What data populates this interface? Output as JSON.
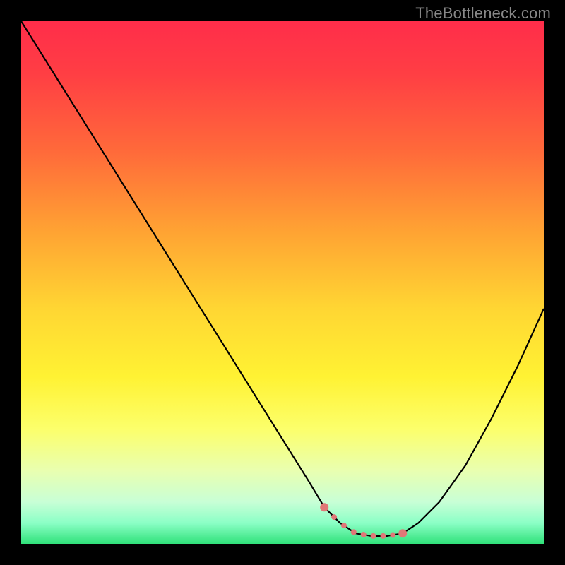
{
  "watermark": "TheBottleneck.com",
  "chart_data": {
    "type": "line",
    "title": "",
    "xlabel": "",
    "ylabel": "",
    "xlim": [
      0,
      100
    ],
    "ylim": [
      0,
      100
    ],
    "x": [
      0,
      5,
      10,
      15,
      20,
      25,
      30,
      35,
      40,
      45,
      50,
      55,
      58,
      61,
      64,
      67,
      70,
      73,
      76,
      80,
      85,
      90,
      95,
      100
    ],
    "values": [
      100,
      92,
      84,
      76,
      68,
      60,
      52,
      44,
      36,
      28,
      20,
      12,
      7,
      4,
      2,
      1.5,
      1.5,
      2,
      4,
      8,
      15,
      24,
      34,
      45
    ],
    "annotations": [
      {
        "type": "highlight",
        "x_range": [
          58,
          73
        ],
        "color": "#e07777",
        "note": "optimal zone dots"
      }
    ],
    "background": "red-to-green vertical heat gradient"
  }
}
